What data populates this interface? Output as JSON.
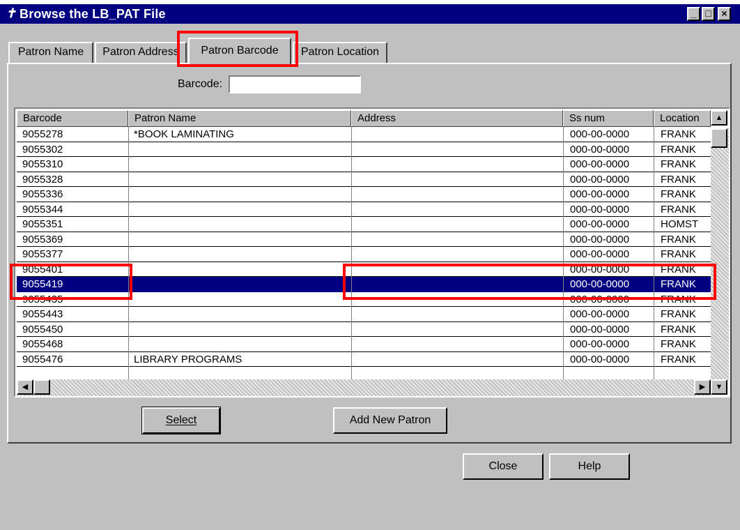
{
  "window": {
    "title": "Browse the LB_PAT File",
    "controls": [
      "_",
      "□",
      "×"
    ]
  },
  "tabs": [
    {
      "label": "Patron Name"
    },
    {
      "label": "Patron Address"
    },
    {
      "label": "Patron Barcode",
      "active": true
    },
    {
      "label": "Patron Location"
    }
  ],
  "search": {
    "label": "Barcode:",
    "value": ""
  },
  "table": {
    "columns": [
      "Barcode",
      "Patron Name",
      "Address",
      "Ss num",
      "Location"
    ],
    "rows": [
      {
        "barcode": "9055278",
        "name": "*BOOK LAMINATING",
        "ss": "000-00-0000",
        "location": "FRANK"
      },
      {
        "barcode": "9055302",
        "name": "",
        "ss": "000-00-0000",
        "location": "FRANK"
      },
      {
        "barcode": "9055310",
        "name": "",
        "ss": "000-00-0000",
        "location": "FRANK"
      },
      {
        "barcode": "9055328",
        "name": "",
        "ss": "000-00-0000",
        "location": "FRANK"
      },
      {
        "barcode": "9055336",
        "name": "",
        "ss": "000-00-0000",
        "location": "FRANK"
      },
      {
        "barcode": "9055344",
        "name": "",
        "ss": "000-00-0000",
        "location": "FRANK"
      },
      {
        "barcode": "9055351",
        "name": "",
        "ss": "000-00-0000",
        "location": "HOMST"
      },
      {
        "barcode": "9055369",
        "name": "",
        "ss": "000-00-0000",
        "location": "FRANK"
      },
      {
        "barcode": "9055377",
        "name": "",
        "ss": "000-00-0000",
        "location": "FRANK"
      },
      {
        "barcode": "9055401",
        "name": "",
        "ss": "000-00-0000",
        "location": "FRANK"
      },
      {
        "barcode": "9055419",
        "name": "",
        "ss": "000-00-0000",
        "location": "FRANK",
        "selected": true
      },
      {
        "barcode": "9055435",
        "name": "",
        "ss": "000-00-0000",
        "location": "FRANK"
      },
      {
        "barcode": "9055443",
        "name": "",
        "ss": "000-00-0000",
        "location": "FRANK"
      },
      {
        "barcode": "9055450",
        "name": "",
        "ss": "000-00-0000",
        "location": "FRANK"
      },
      {
        "barcode": "9055468",
        "name": "",
        "ss": "000-00-0000",
        "location": "FRANK"
      },
      {
        "barcode": "9055476",
        "name": "LIBRARY PROGRAMS",
        "ss": "000-00-0000",
        "location": "FRANK"
      }
    ]
  },
  "buttons": {
    "select": "Select",
    "add_new_patron": "Add New Patron",
    "close": "Close",
    "help": "Help"
  },
  "colors": {
    "title_bar": "#000080",
    "selection": "#000080",
    "highlight": "#ff0000"
  }
}
